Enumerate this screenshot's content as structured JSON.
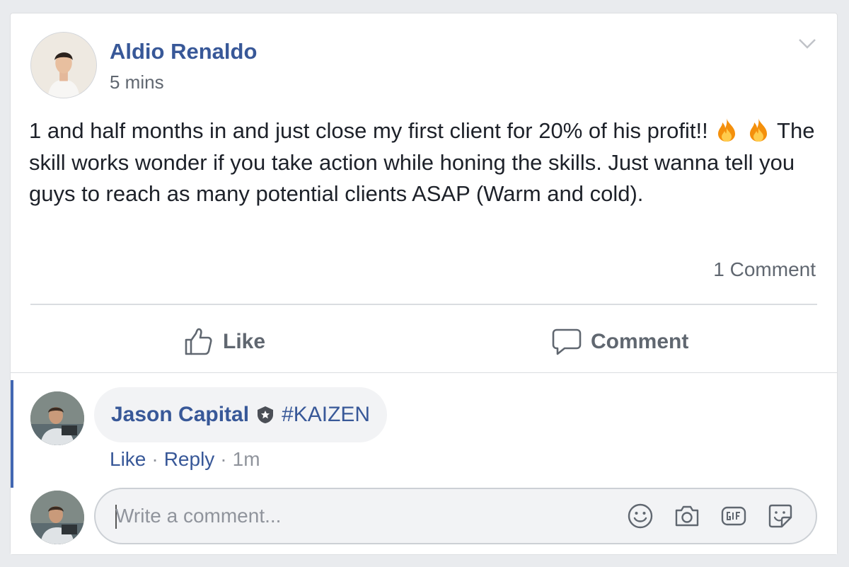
{
  "post": {
    "author": "Aldio Renaldo",
    "timestamp": "5 mins",
    "text_line1": "1 and half months in and just close my first client for 20% of his profit!!",
    "text_line2": "The skill works wonder if you take action while honing the skills. Just wanna tell you guys to reach as many potential clients ASAP (Warm and cold).",
    "emoji": "fire-emoji",
    "comment_count": "1 Comment"
  },
  "actions": {
    "like_label": "Like",
    "comment_label": "Comment"
  },
  "comments": [
    {
      "author": "Jason Capital",
      "tag": "#KAIZEN",
      "like_label": "Like",
      "reply_label": "Reply",
      "separator": "·",
      "time": "1m"
    }
  ],
  "composer": {
    "placeholder": "Write a comment...",
    "icons": [
      "emoji-icon",
      "camera-icon",
      "gif-icon",
      "sticker-icon"
    ]
  },
  "colors": {
    "link_blue": "#385898",
    "accent_bar": "#4267b2",
    "muted_text": "#606770",
    "background": "#e9ebee"
  }
}
